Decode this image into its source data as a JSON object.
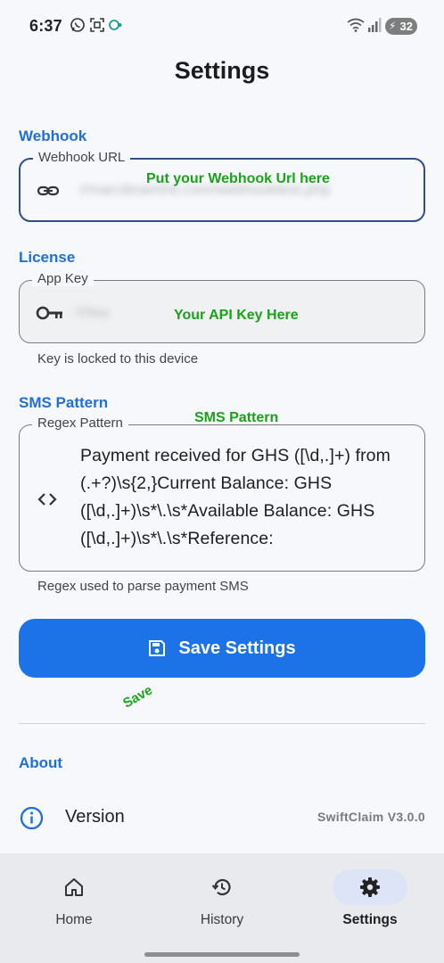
{
  "status_bar": {
    "time": "6:37",
    "battery": "32"
  },
  "page": {
    "title": "Settings"
  },
  "webhook": {
    "section": "Webhook",
    "field_label": "Webhook URL",
    "value": "//marcibraimhit.com/webhooktest.php",
    "annotation": "Put your Webhook Url here"
  },
  "license": {
    "section": "License",
    "field_label": "App Key",
    "value": "-Yhru",
    "annotation": "Your API Key Here",
    "helper": "Key is locked to this device"
  },
  "sms": {
    "section": "SMS Pattern",
    "annotation": "SMS Pattern",
    "field_label": "Regex Pattern",
    "value": "Payment received for GHS ([\\d,.]+) from (.+?)\\s{2,}Current Balance: GHS ([\\d,.]+)\\s*\\.\\s*Available Balance: GHS ([\\d,.]+)\\s*\\.\\s*Reference:",
    "helper": "Regex used to parse payment SMS"
  },
  "save": {
    "label": "Save Settings",
    "annotation": "Save"
  },
  "about": {
    "section": "About",
    "version_label": "Version",
    "version_value": "SwiftClaim V3.0.0"
  },
  "nav": {
    "items": [
      {
        "label": "Home",
        "icon": "home-icon"
      },
      {
        "label": "History",
        "icon": "history-icon"
      },
      {
        "label": "Settings",
        "icon": "gear-icon",
        "active": true
      }
    ]
  },
  "colors": {
    "accent": "#1f6fd8",
    "button": "#1c73e8",
    "annotation": "#1aa31a"
  }
}
